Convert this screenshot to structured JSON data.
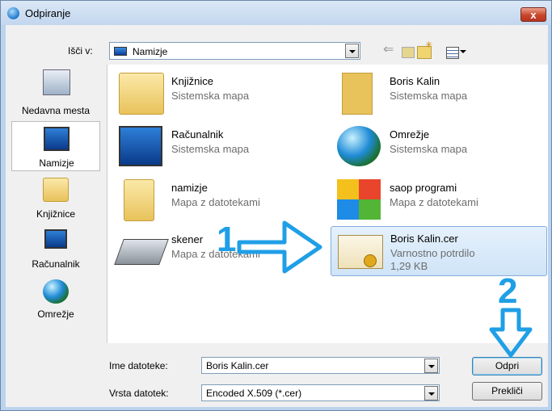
{
  "window": {
    "title": "Odpiranje",
    "close_label": "x"
  },
  "lookin": {
    "label": "Išči v:",
    "value": "Namizje"
  },
  "places": [
    {
      "label": "Nedavna mesta"
    },
    {
      "label": "Namizje"
    },
    {
      "label": "Knjižnice"
    },
    {
      "label": "Računalnik"
    },
    {
      "label": "Omrežje"
    }
  ],
  "items": [
    {
      "name": "Knjižnice",
      "sub": "Sistemska mapa",
      "icon": "library-icon"
    },
    {
      "name": "Boris Kalin",
      "sub": "Sistemska mapa",
      "icon": "user-folder-icon"
    },
    {
      "name": "Računalnik",
      "sub": "Sistemska mapa",
      "icon": "computer-icon"
    },
    {
      "name": "Omrežje",
      "sub": "Sistemska mapa",
      "icon": "network-icon"
    },
    {
      "name": "namizje",
      "sub": "Mapa z datotekami",
      "icon": "folder-icon"
    },
    {
      "name": "saop programi",
      "sub": "Mapa z datotekami",
      "icon": "windows-folder-icon"
    },
    {
      "name": "skener",
      "sub": "Mapa z datotekami",
      "icon": "scanner-icon"
    },
    {
      "name": "Boris Kalin.cer",
      "sub": "Varnostno potrdilo",
      "size": "1,29 KB",
      "icon": "certificate-icon"
    }
  ],
  "filename": {
    "label": "Ime datoteke:",
    "value": "Boris Kalin.cer"
  },
  "filetype": {
    "label": "Vrsta datotek:",
    "value": "Encoded X.509 (*.cer)"
  },
  "buttons": {
    "open": "Odpri",
    "cancel": "Prekliči"
  },
  "annotations": {
    "step1": "1",
    "step2": "2"
  },
  "colors": {
    "annotation": "#1f9fe6",
    "selection": "#cfe4f8"
  }
}
